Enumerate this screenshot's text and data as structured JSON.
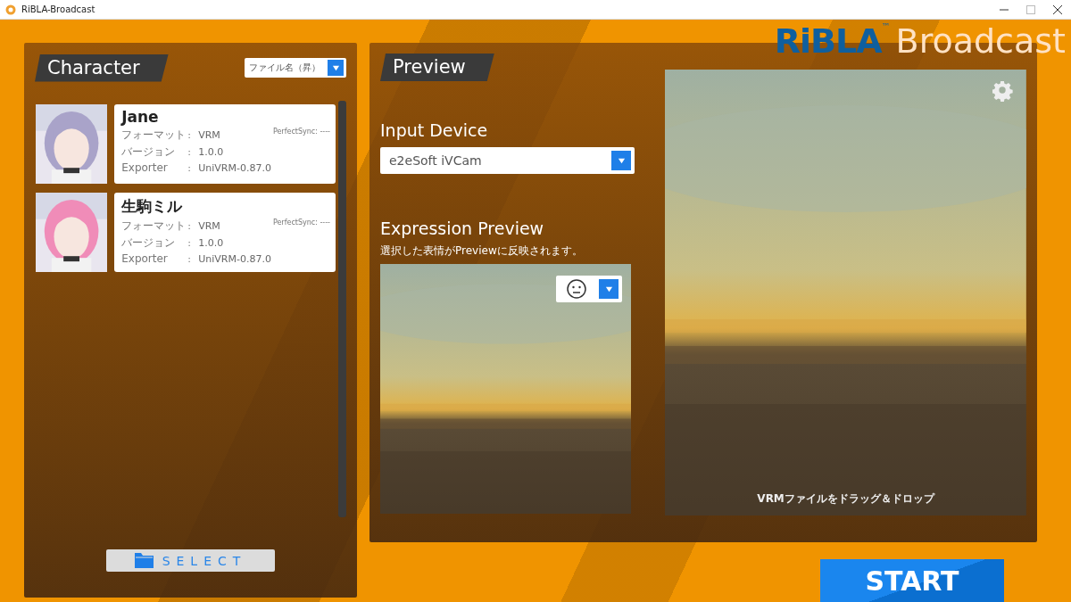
{
  "window": {
    "title": "RiBLA-Broadcast"
  },
  "logo": {
    "brand": "RiBLA",
    "trademark": "™",
    "product": "Broadcast"
  },
  "character_panel": {
    "title": "Character",
    "sort": {
      "value": "ファイル名（昇）"
    },
    "characters": [
      {
        "name": "Jane",
        "perfect_sync": "PerfectSync: ----",
        "fields": [
          {
            "label": "フォーマット",
            "separator": ":",
            "value": "VRM"
          },
          {
            "label": "バージョン",
            "separator": ":",
            "value": "1.0.0"
          },
          {
            "label": "Exporter",
            "separator": ":",
            "value": "UniVRM-0.87.0"
          }
        ]
      },
      {
        "name": "生駒ミル",
        "perfect_sync": "PerfectSync: ----",
        "fields": [
          {
            "label": "フォーマット",
            "separator": ":",
            "value": "VRM"
          },
          {
            "label": "バージョン",
            "separator": ":",
            "value": "1.0.0"
          },
          {
            "label": "Exporter",
            "separator": ":",
            "value": "UniVRM-0.87.0"
          }
        ]
      }
    ],
    "select_button": "SELECT"
  },
  "preview_panel": {
    "title": "Preview",
    "input_device": {
      "label": "Input Device",
      "value": "e2eSoft iVCam"
    },
    "expression_preview": {
      "label": "Expression Preview",
      "hint": "選択した表情がPreviewに反映されます。"
    },
    "drop_hint": "VRMファイルをドラッグ＆ドロップ"
  },
  "start_button": "START"
}
